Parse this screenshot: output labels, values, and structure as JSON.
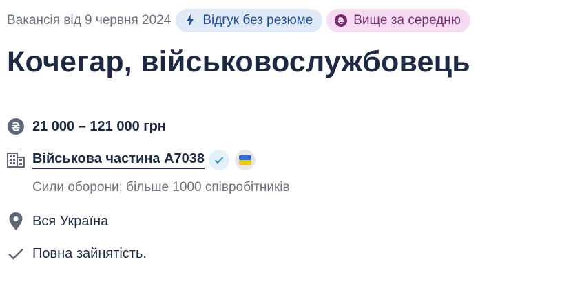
{
  "header": {
    "date": "Вакансія від 9 червня 2024",
    "badges": [
      {
        "label": "Відгук без резюме",
        "icon": "lightning-icon",
        "color": "#1c4f9c"
      },
      {
        "label": "Вище за середню",
        "icon": "hryvnia-icon",
        "color": "#7b2a6f"
      }
    ]
  },
  "title": "Кочегар, військовослужбовець",
  "details": {
    "salary": "21 000 – 121 000 грн",
    "company": "Військова частина А7038",
    "company_description": "Сили оборони; більше 1000 співробітників",
    "location": "Вся Україна",
    "employment": "Повна зайнятість."
  },
  "icons": {
    "salary": "hryvnia-circle-icon",
    "company": "building-icon",
    "verified": "check-verified-icon",
    "flag": "ukraine-flag-icon",
    "location": "map-pin-icon",
    "employment": "check-icon"
  }
}
